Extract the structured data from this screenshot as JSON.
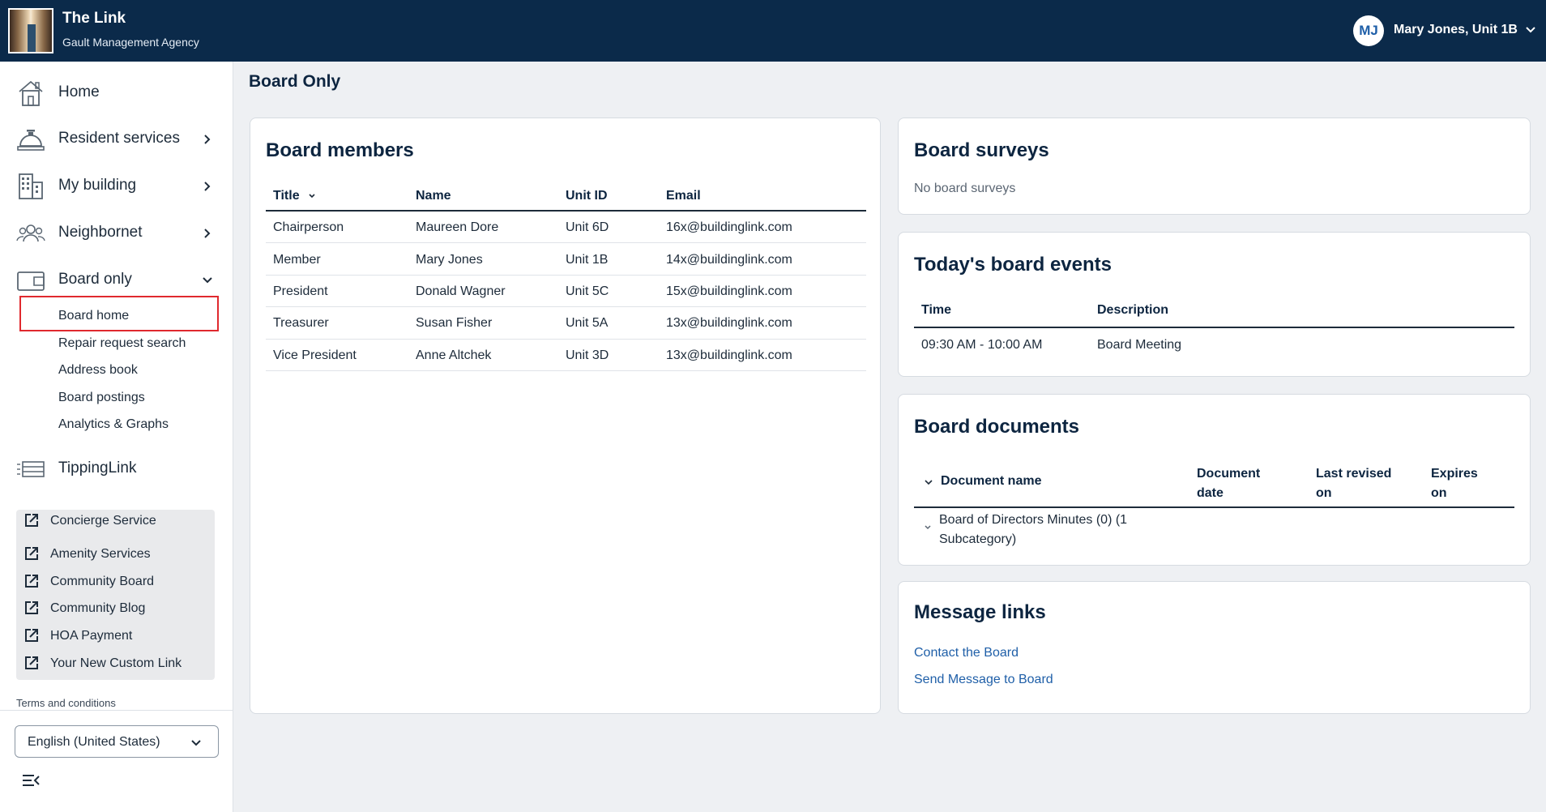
{
  "header": {
    "app_title": "The Link",
    "agency": "Gault Management Agency",
    "user_initials": "MJ",
    "user_name": "Mary Jones, Unit 1B"
  },
  "sidebar": {
    "items": [
      {
        "label": "Home",
        "icon": "home-icon"
      },
      {
        "label": "Resident services",
        "icon": "concierge-bell-icon"
      },
      {
        "label": "My building",
        "icon": "building-icon"
      },
      {
        "label": "Neighbornet",
        "icon": "people-icon"
      },
      {
        "label": "Board only",
        "icon": "folder-icon"
      },
      {
        "label": "TippingLink",
        "icon": "list-icon"
      }
    ],
    "board_subitems": [
      "Board home",
      "Repair request search",
      "Address book",
      "Board postings",
      "Analytics & Graphs"
    ],
    "custom_links": [
      "Concierge Service",
      "Amenity Services",
      "Community Board",
      "Community Blog",
      "HOA Payment",
      "Your New Custom Link"
    ],
    "terms": "Terms and conditions",
    "language": "English (United States)"
  },
  "main": {
    "page_title": "Board Only",
    "board_members": {
      "title": "Board members",
      "headers": [
        "Title",
        "Name",
        "Unit ID",
        "Email"
      ],
      "rows": [
        [
          "Chairperson",
          "Maureen Dore",
          "Unit 6D",
          "16x@buildinglink.com"
        ],
        [
          "Member",
          "Mary Jones",
          "Unit 1B",
          "14x@buildinglink.com"
        ],
        [
          "President",
          "Donald Wagner",
          "Unit 5C",
          "15x@buildinglink.com"
        ],
        [
          "Treasurer",
          "Susan Fisher",
          "Unit 5A",
          "13x@buildinglink.com"
        ],
        [
          "Vice President",
          "Anne Altchek",
          "Unit 3D",
          "13x@buildinglink.com"
        ]
      ]
    },
    "board_surveys": {
      "title": "Board surveys",
      "empty_text": "No board surveys"
    },
    "board_events": {
      "title": "Today's board events",
      "headers": [
        "Time",
        "Description"
      ],
      "rows": [
        [
          "09:30 AM - 10:00 AM",
          "Board Meeting"
        ]
      ]
    },
    "board_documents": {
      "title": "Board documents",
      "col_document_name": "Document name",
      "col_document_date": [
        "Document",
        "date"
      ],
      "col_last_revised": [
        "Last revised",
        "on"
      ],
      "col_expires": [
        "Expires",
        "on"
      ],
      "category": [
        "Board of Directors Minutes (0) (1",
        "Subcategory)"
      ]
    },
    "message_links": {
      "title": "Message links",
      "links": [
        "Contact the Board",
        "Send Message to Board"
      ]
    }
  }
}
